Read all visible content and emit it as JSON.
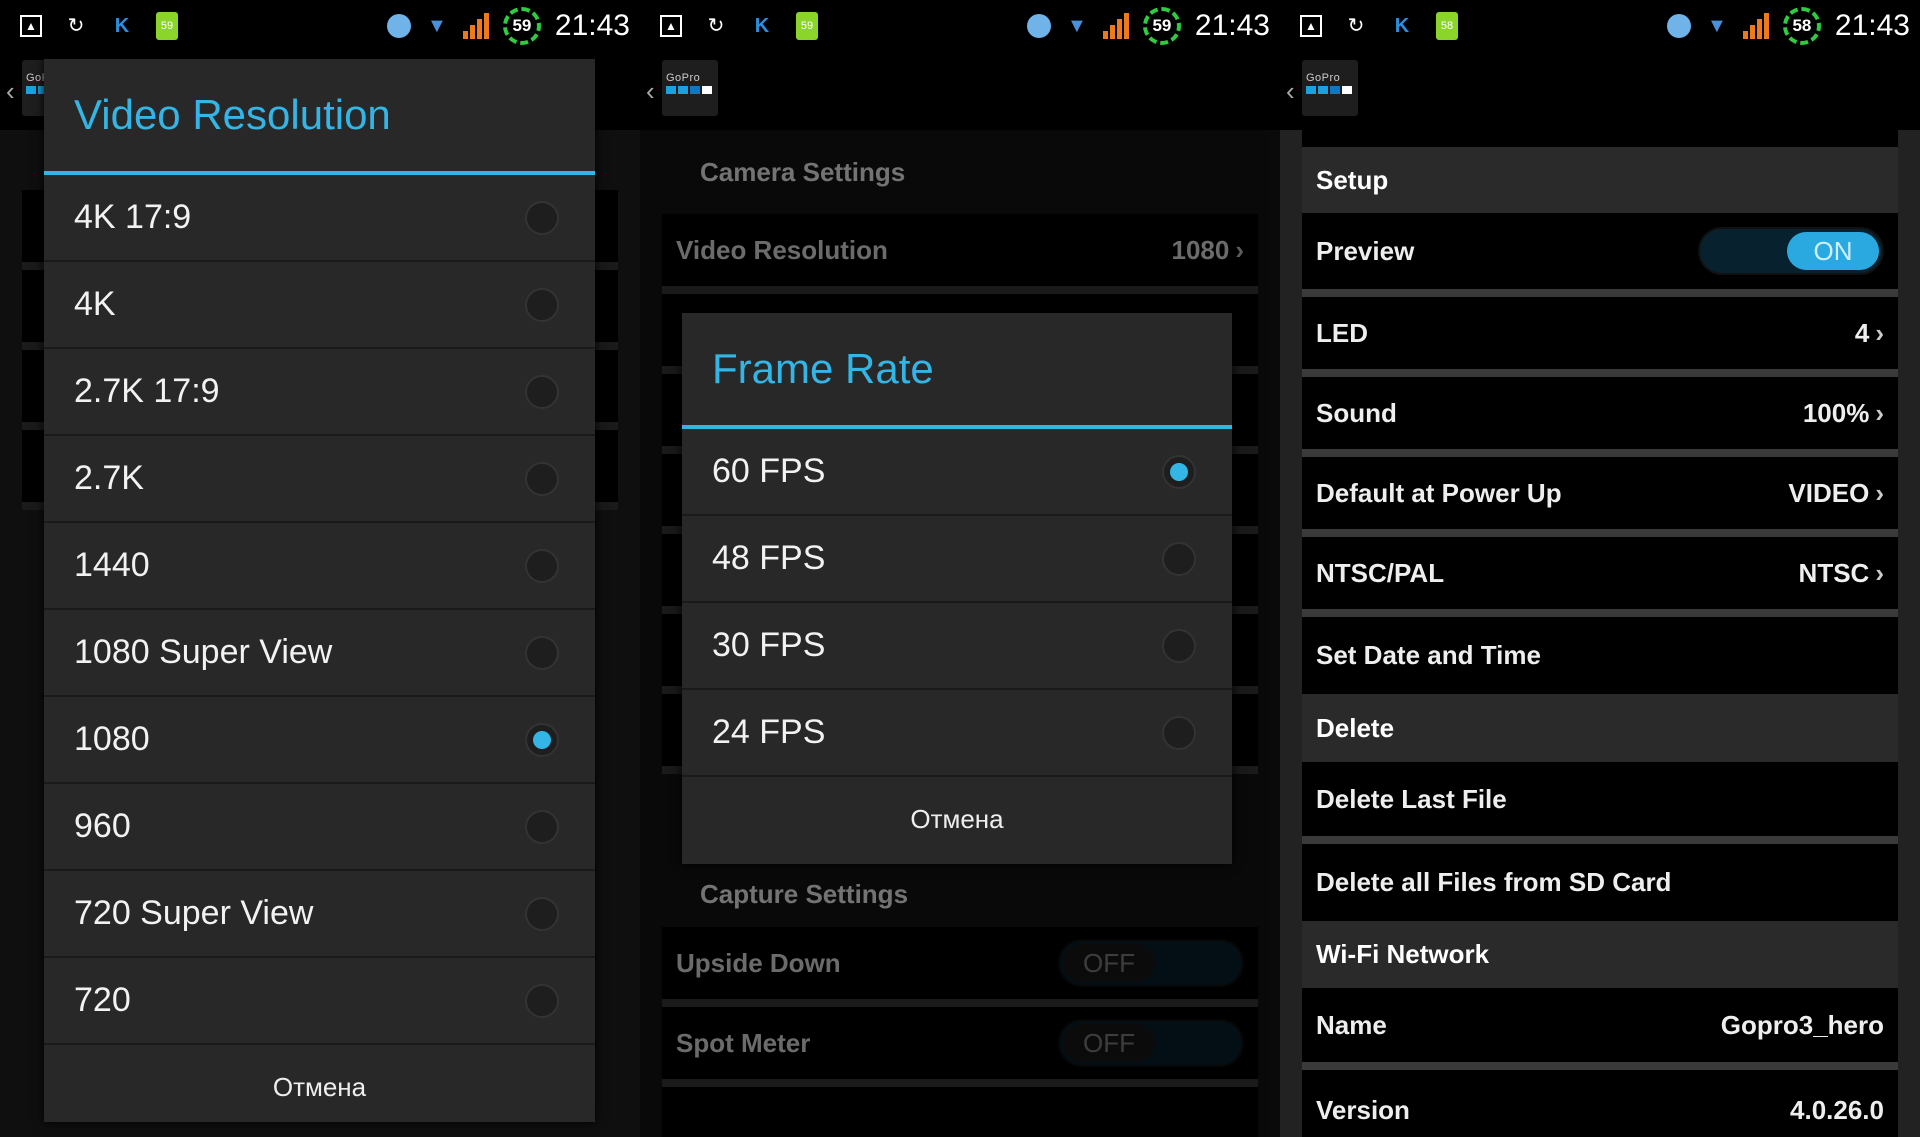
{
  "panels": [
    {
      "status": {
        "battery": "59",
        "clock_ring": "59",
        "time": "21:43"
      }
    },
    {
      "status": {
        "battery": "59",
        "clock_ring": "59",
        "time": "21:43"
      }
    },
    {
      "status": {
        "battery": "58",
        "clock_ring": "58",
        "time": "21:43"
      }
    }
  ],
  "logo_text": "GoPro",
  "status_icons": [
    "gallery-icon",
    "sync-icon",
    "k-app-icon",
    "battery-icon",
    "alarm-icon",
    "wifi-icon",
    "signal-icon",
    "clock-ring-icon"
  ],
  "video_dialog": {
    "title": "Video Resolution",
    "options": [
      "4K 17:9",
      "4K",
      "2.7K 17:9",
      "2.7K",
      "1440",
      "1080 Super View",
      "1080",
      "960",
      "720 Super View",
      "720"
    ],
    "selected": "1080",
    "cancel": "Отмена"
  },
  "camera_settings": {
    "header": "Camera Settings",
    "video_resolution": {
      "label": "Video Resolution",
      "value": "1080"
    },
    "capture_header": "Capture Settings",
    "upside_down": {
      "label": "Upside Down",
      "value": "OFF"
    },
    "spot_meter": {
      "label": "Spot Meter",
      "value": "OFF"
    }
  },
  "frame_dialog": {
    "title": "Frame Rate",
    "options": [
      "60 FPS",
      "48 FPS",
      "30 FPS",
      "24 FPS"
    ],
    "selected": "60 FPS",
    "cancel": "Отмена"
  },
  "setup": {
    "header": "Setup",
    "preview": {
      "label": "Preview",
      "value": "ON"
    },
    "led": {
      "label": "LED",
      "value": "4"
    },
    "sound": {
      "label": "Sound",
      "value": "100%"
    },
    "default_power": {
      "label": "Default at Power Up",
      "value": "VIDEO"
    },
    "ntsc": {
      "label": "NTSC/PAL",
      "value": "NTSC"
    },
    "date": {
      "label": "Set Date and Time"
    }
  },
  "delete": {
    "header": "Delete",
    "last": "Delete Last File",
    "all": "Delete all Files from SD Card"
  },
  "wifi": {
    "header": "Wi-Fi Network",
    "name": {
      "label": "Name",
      "value": "Gopro3_hero"
    },
    "version": {
      "label": "Version",
      "value": "4.0.26.0"
    }
  },
  "accent": "#33b5e5"
}
